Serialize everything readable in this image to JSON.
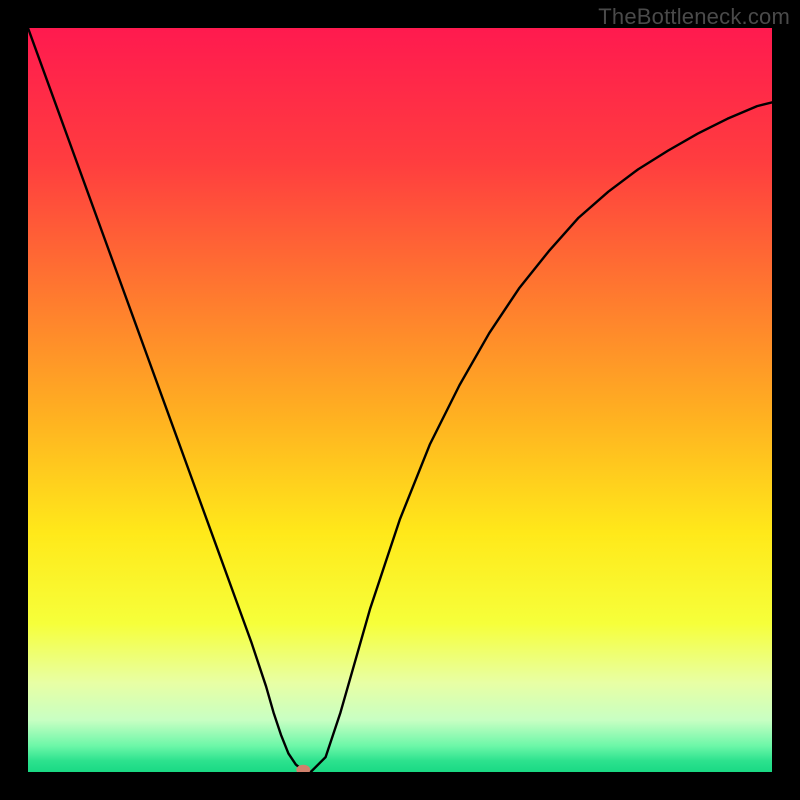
{
  "watermark": "TheBottleneck.com",
  "chart_data": {
    "type": "line",
    "title": "",
    "xlabel": "",
    "ylabel": "",
    "xlim": [
      0,
      100
    ],
    "ylim": [
      0,
      100
    ],
    "x": [
      0,
      2,
      4,
      6,
      8,
      10,
      12,
      14,
      16,
      18,
      20,
      22,
      24,
      26,
      28,
      30,
      32,
      33,
      34,
      35,
      36,
      37,
      38,
      40,
      42,
      44,
      46,
      48,
      50,
      54,
      58,
      62,
      66,
      70,
      74,
      78,
      82,
      86,
      90,
      94,
      98,
      100
    ],
    "values": [
      100,
      94.5,
      89,
      83.5,
      78,
      72.5,
      67,
      61.5,
      56,
      50.5,
      45,
      39.5,
      34,
      28.5,
      23,
      17.5,
      11.5,
      8,
      5,
      2.5,
      1,
      0.2,
      0,
      2,
      8,
      15,
      22,
      28,
      34,
      44,
      52,
      59,
      65,
      70,
      74.5,
      78,
      81,
      83.5,
      85.8,
      87.8,
      89.5,
      90
    ],
    "marker": {
      "x": 37,
      "y": 0.3,
      "color": "#d0816c"
    },
    "background_gradient": {
      "stops": [
        {
          "offset": 0.0,
          "color": "#ff1a4f"
        },
        {
          "offset": 0.18,
          "color": "#ff3d3f"
        },
        {
          "offset": 0.36,
          "color": "#ff7a2f"
        },
        {
          "offset": 0.52,
          "color": "#ffb021"
        },
        {
          "offset": 0.68,
          "color": "#ffe91a"
        },
        {
          "offset": 0.8,
          "color": "#f6ff3a"
        },
        {
          "offset": 0.88,
          "color": "#e8ffa4"
        },
        {
          "offset": 0.93,
          "color": "#c8ffc3"
        },
        {
          "offset": 0.965,
          "color": "#6cf7a8"
        },
        {
          "offset": 0.985,
          "color": "#2de28e"
        },
        {
          "offset": 1.0,
          "color": "#19d984"
        }
      ]
    },
    "line_color": "#000000"
  }
}
